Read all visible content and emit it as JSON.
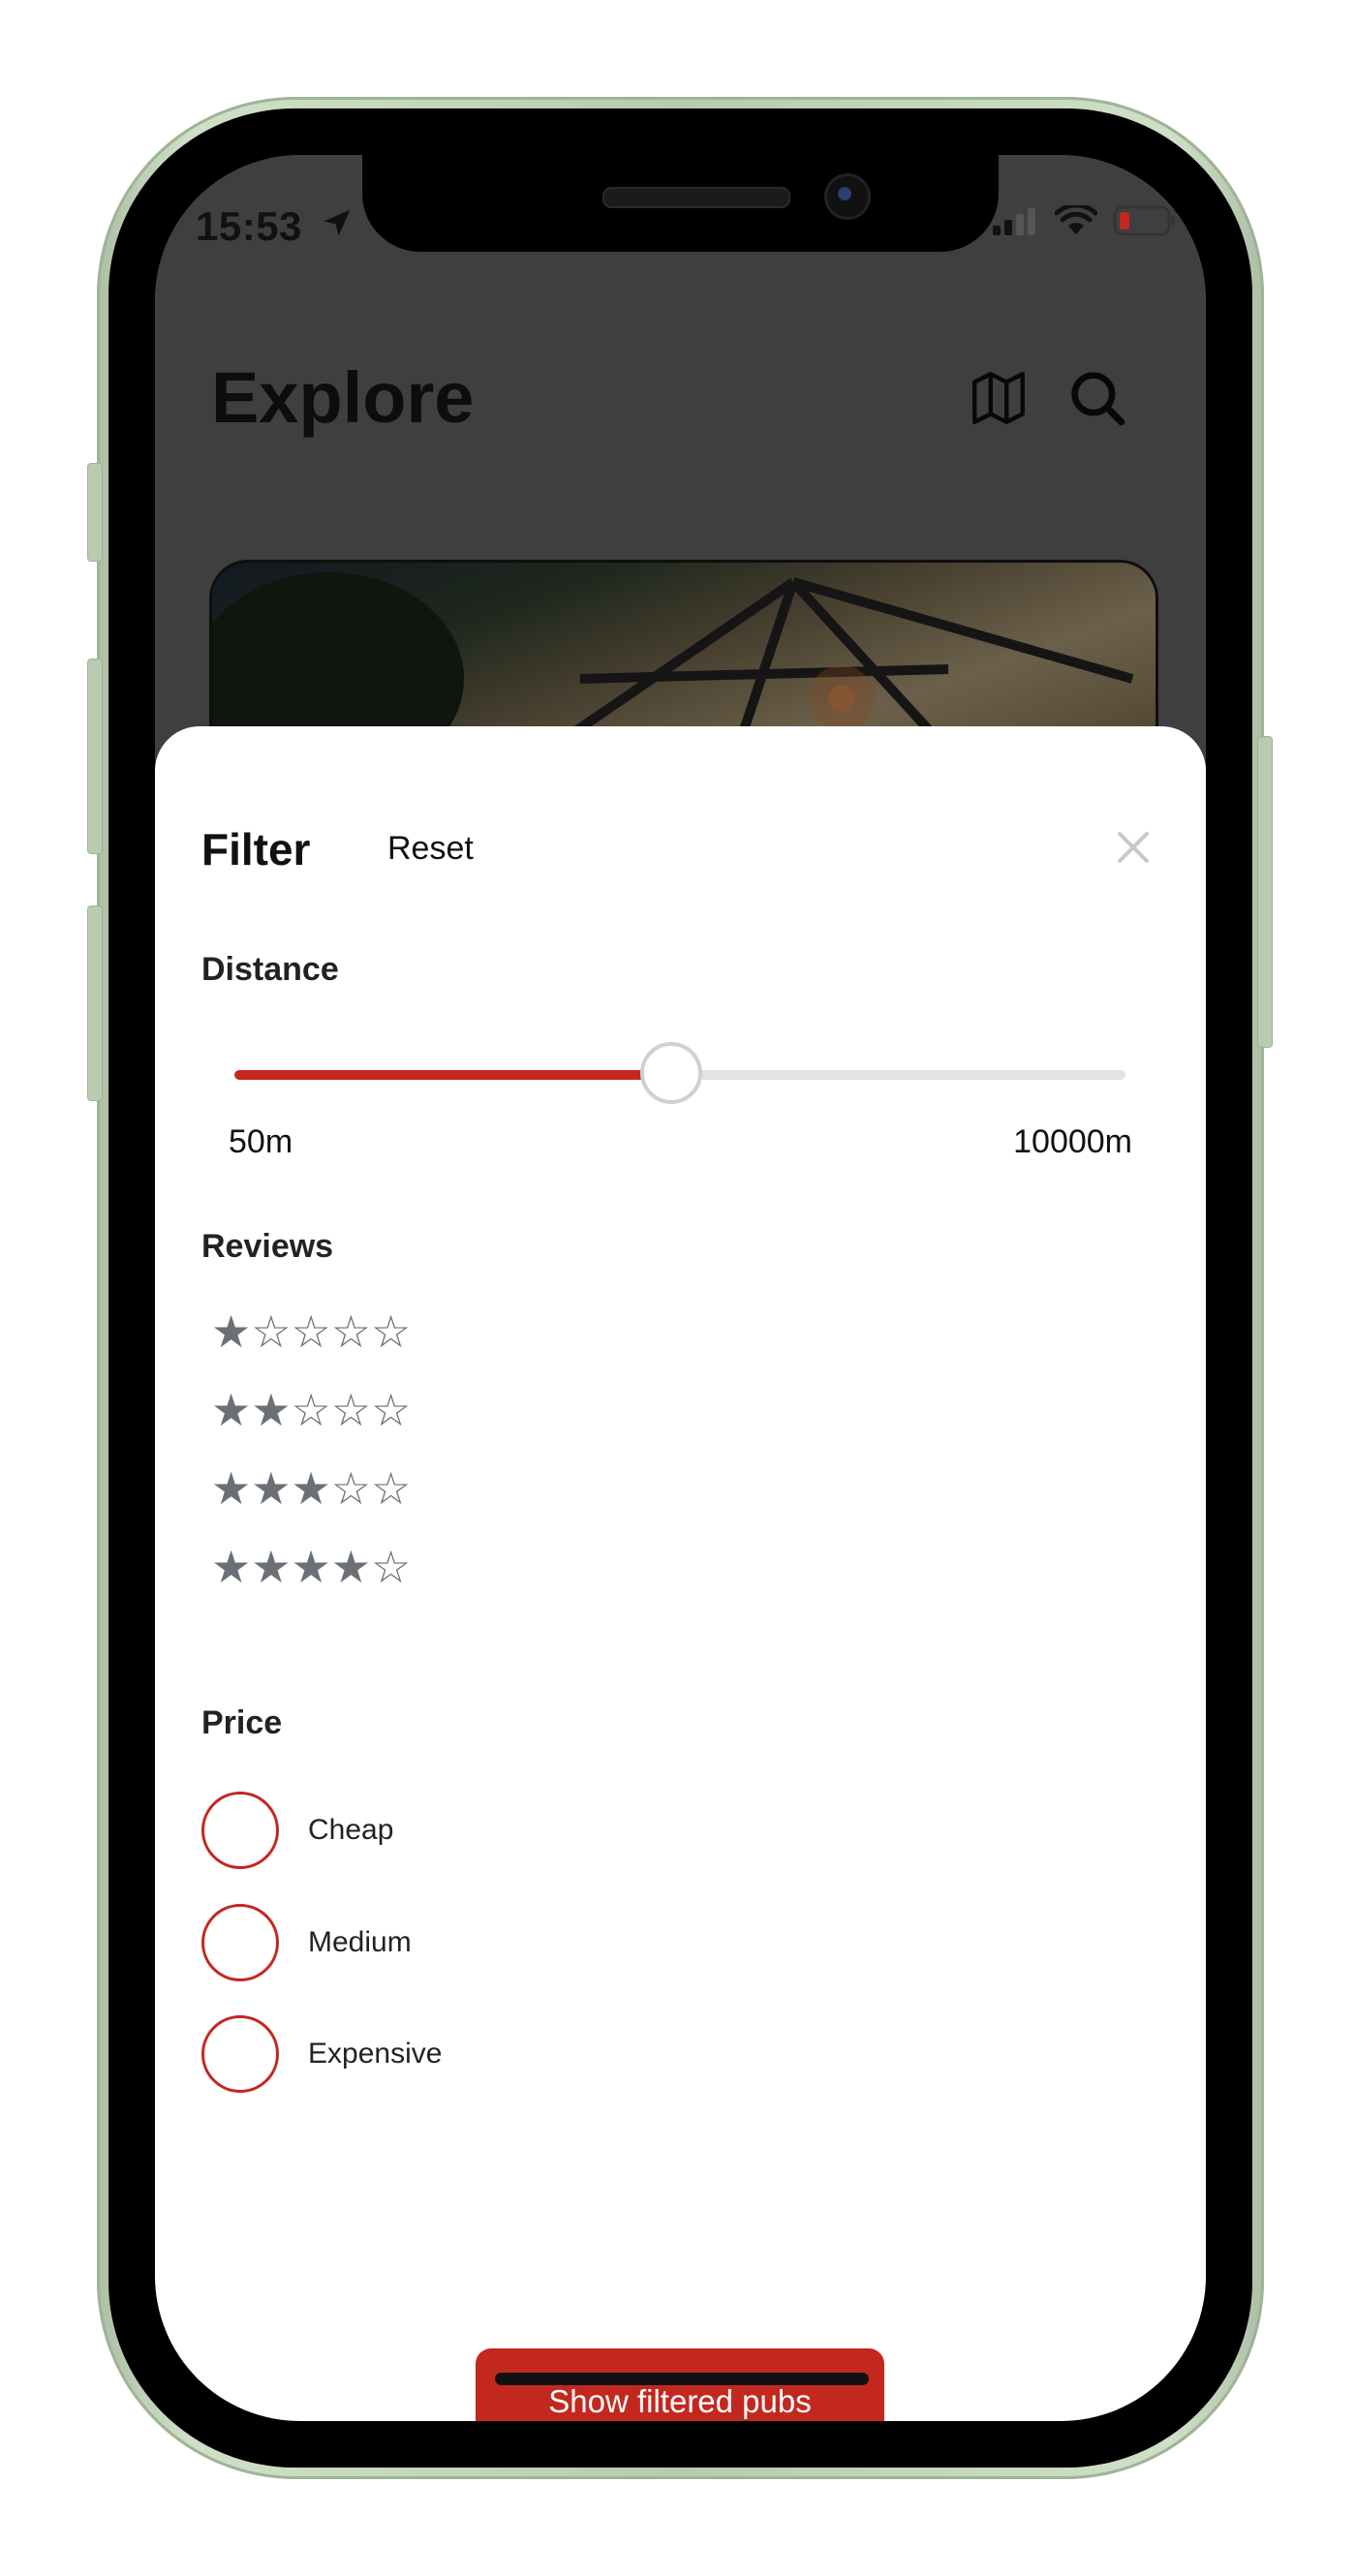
{
  "status_bar": {
    "time": "15:53"
  },
  "explore": {
    "title": "Explore"
  },
  "filter": {
    "title": "Filter",
    "reset_label": "Reset",
    "close_icon": "close-icon",
    "distance": {
      "label": "Distance",
      "min_label": "50m",
      "max_label": "10000m",
      "value_fraction": 0.49
    },
    "reviews": {
      "label": "Reviews",
      "options": [
        {
          "stars": "★☆☆☆☆",
          "filled": 1
        },
        {
          "stars": "★★☆☆☆",
          "filled": 2
        },
        {
          "stars": "★★★☆☆",
          "filled": 3
        },
        {
          "stars": "★★★★☆",
          "filled": 4
        }
      ]
    },
    "price": {
      "label": "Price",
      "options": [
        {
          "label": "Cheap",
          "selected": false
        },
        {
          "label": "Medium",
          "selected": false
        },
        {
          "label": "Expensive",
          "selected": false
        }
      ]
    },
    "submit_label": "Show filtered pubs"
  },
  "colors": {
    "accent": "#c3281f",
    "star": "#6b7077",
    "track": "#e2e2e2"
  }
}
